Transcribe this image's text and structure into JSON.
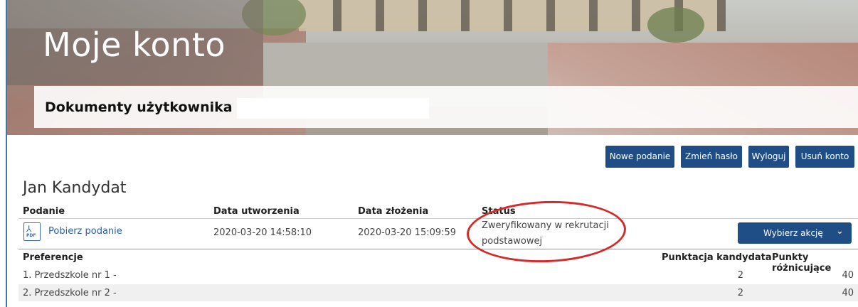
{
  "header": {
    "title": "Moje konto",
    "subtitle": "Dokumenty użytkownika"
  },
  "actions": {
    "new_application": "Nowe podanie",
    "change_password": "Zmień hasło",
    "logout": "Wyloguj",
    "delete_account": "Usuń konto"
  },
  "candidate": {
    "name": "Jan Kandydat"
  },
  "application_table": {
    "columns": [
      "Podanie",
      "Data utworzenia",
      "Data złożenia",
      "Status"
    ],
    "row": {
      "icon": "pdf-icon",
      "link": "Pobierz podanie",
      "created": "2020-03-20 14:58:10",
      "submitted": "2020-03-20 15:09:59",
      "status_line1": "Zweryfikowany w rekrutacji",
      "status_line2": "podstawowej",
      "action_label": "Wybierz akcję"
    }
  },
  "preferences": {
    "columns": [
      "Preferencje",
      "Punktacja kandydata",
      "Punkty różnicujące"
    ],
    "rows": [
      {
        "name": "1. Przedszkole nr 1 -",
        "score": "2",
        "diff": "40"
      },
      {
        "name": "2. Przedszkole nr 2 -",
        "score": "2",
        "diff": "40"
      }
    ]
  },
  "colors": {
    "primary": "#1f4e87",
    "annotation": "#d42a2a"
  }
}
